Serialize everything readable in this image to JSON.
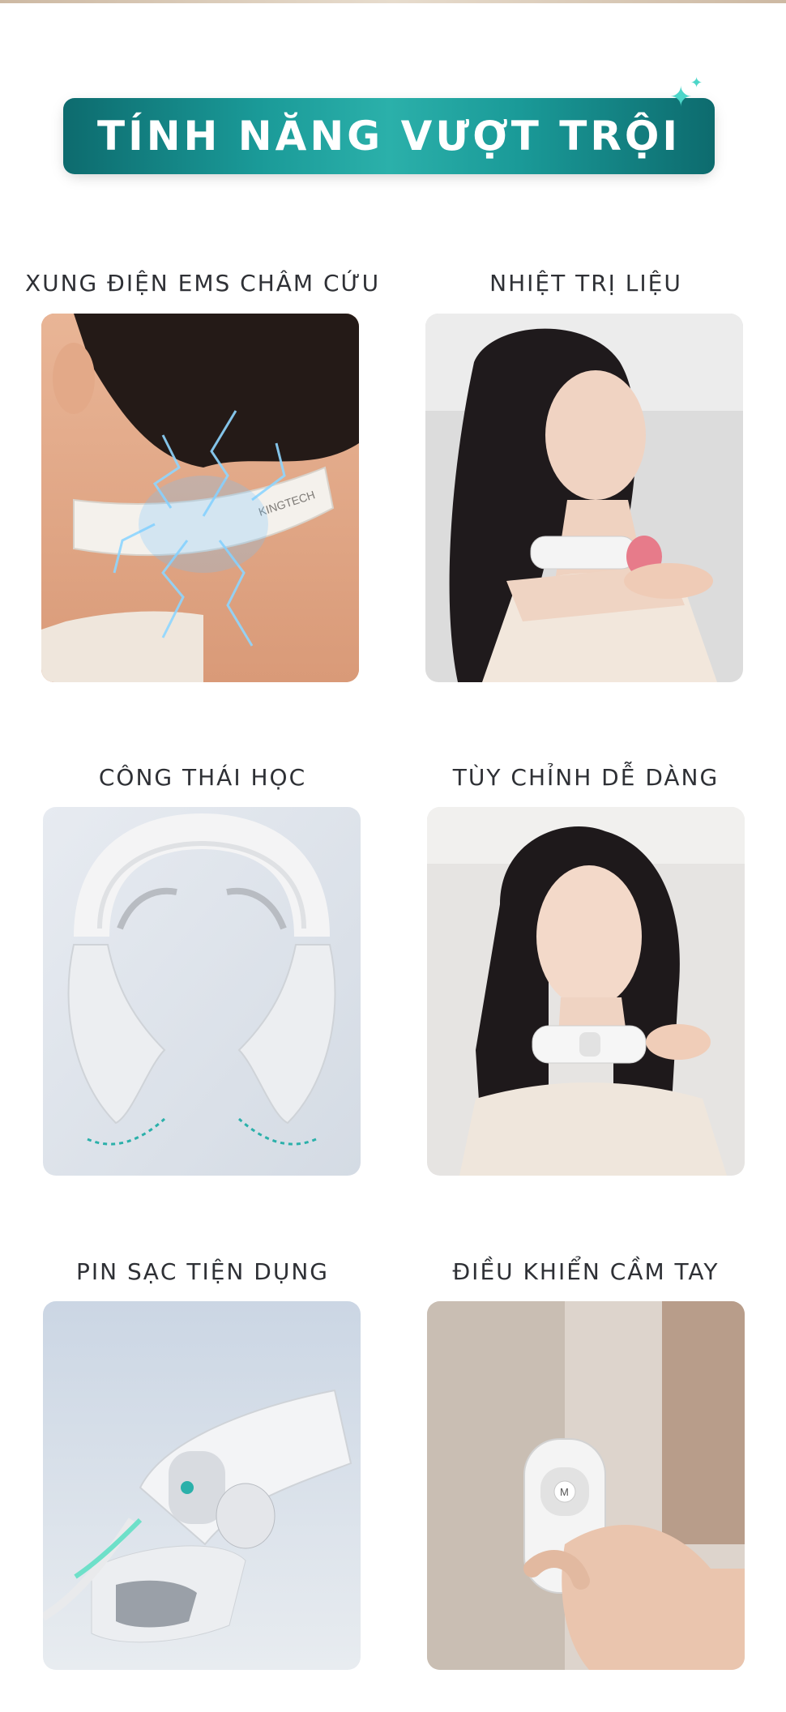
{
  "header": {
    "title": "TÍNH NĂNG VƯỢT TRỘI",
    "sparkle_icon": "sparkle-icon"
  },
  "features": [
    {
      "label": "XUNG ĐIỆN EMS CHÂM CỨU",
      "image": "neck-massager-ems-lightning"
    },
    {
      "label": "NHIỆT TRỊ LIỆU",
      "image": "woman-wearing-heated-neck-massager"
    },
    {
      "label": "CÔNG THÁI HỌC",
      "image": "neck-massager-ergonomic-arms"
    },
    {
      "label": "TÙY CHỈNH DỄ DÀNG",
      "image": "woman-adjusting-neck-massager"
    },
    {
      "label": "PIN SẠC TIỆN DỤNG",
      "image": "neck-massager-charging-cable"
    },
    {
      "label": "ĐIỀU KHIỂN CẦM TAY",
      "image": "hand-holding-remote-control"
    }
  ],
  "brand": {
    "logo_text": "KINGTECH"
  },
  "colors": {
    "accent": "#1a9a98",
    "accent_dark": "#0d6b6e",
    "label": "#2e3035"
  }
}
